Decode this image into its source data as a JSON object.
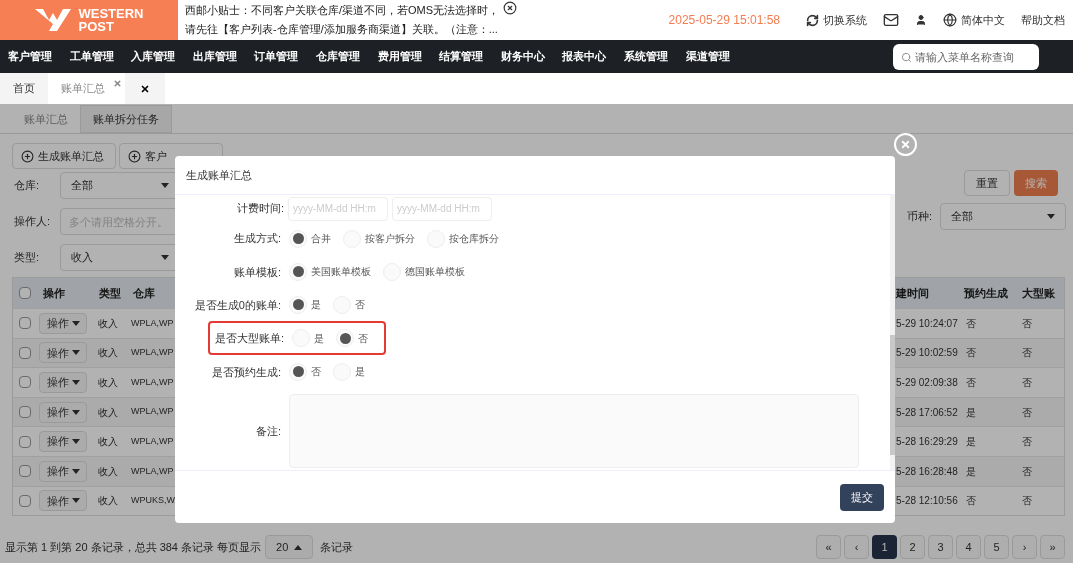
{
  "header": {
    "logo_lines": [
      "WESTERN",
      "POST"
    ],
    "notice_lines": [
      "西邮小贴士：不同客户关联仓库/渠道不同，若OMS无法选择时，",
      "请先往【客户列表-仓库管理/添加服务商渠道】关联。（注意：..."
    ],
    "datetime": "2025-05-29 15:01:58",
    "actions": [
      {
        "kind": "switch",
        "label": "切换系统"
      },
      {
        "kind": "mail"
      },
      {
        "kind": "user"
      },
      {
        "kind": "language",
        "label": "简体中文"
      },
      {
        "kind": "help",
        "label": "帮助文档"
      }
    ]
  },
  "menu": {
    "items": [
      "客户管理",
      "工单管理",
      "入库管理",
      "出库管理",
      "订单管理",
      "仓库管理",
      "费用管理",
      "结算管理",
      "财务中心",
      "报表中心",
      "系统管理",
      "渠道管理"
    ],
    "search": {
      "placeholder": "请输入菜单名称查询"
    }
  },
  "page_tabs": [
    {
      "label": "首页",
      "selected": false,
      "closable": false
    },
    {
      "label": "账单汇总",
      "selected": true,
      "closable": true
    }
  ],
  "sub_tabs": [
    {
      "label": "账单汇总",
      "selected": true
    },
    {
      "label": "账单拆分任务",
      "selected": false
    }
  ],
  "toolbar": [
    "生成账单汇总",
    "客户"
  ],
  "filters": {
    "left": [
      {
        "label": "仓库:",
        "kind": "select",
        "value": "全部"
      },
      {
        "label": "操作人:",
        "kind": "input",
        "placeholder": "多个请用空格分开。"
      },
      {
        "label": "类型:",
        "kind": "select",
        "value": "收入"
      }
    ],
    "buttons": [
      {
        "label": "重置",
        "kind": "default"
      },
      {
        "label": "搜索",
        "kind": "primary"
      }
    ],
    "right": [
      {
        "label": "币种:",
        "kind": "select",
        "value": "全部"
      }
    ]
  },
  "table": {
    "all_checked": false,
    "columns": [
      "操作",
      "类型",
      "仓库",
      "建时间",
      "预约生成",
      "大型账"
    ],
    "rows": [
      {
        "checked": false,
        "action": "操作",
        "type": "收入",
        "warehouse": "WPLA,WP",
        "created": "5-29 10:24:07",
        "scheduled": "否",
        "large": "否"
      },
      {
        "checked": false,
        "action": "操作",
        "type": "收入",
        "warehouse": "WPLA,WP",
        "created": "5-29 10:02:59",
        "scheduled": "否",
        "large": "否"
      },
      {
        "checked": false,
        "action": "操作",
        "type": "收入",
        "warehouse": "WPLA,WP",
        "created": "5-29 02:09:38",
        "scheduled": "否",
        "large": "否"
      },
      {
        "checked": false,
        "action": "操作",
        "type": "收入",
        "warehouse": "WPLA,WP",
        "created": "5-28 17:06:52",
        "scheduled": "是",
        "large": "否"
      },
      {
        "checked": false,
        "action": "操作",
        "type": "收入",
        "warehouse": "WPLA,WP",
        "created": "5-28 16:29:29",
        "scheduled": "是",
        "large": "否"
      },
      {
        "checked": false,
        "action": "操作",
        "type": "收入",
        "warehouse": "WPLA,WP",
        "created": "5-28 16:28:48",
        "scheduled": "是",
        "large": "否"
      },
      {
        "checked": false,
        "action": "操作",
        "type": "收入",
        "warehouse": "WPUKS,W",
        "created": "5-28 12:10:56",
        "scheduled": "否",
        "large": "否"
      }
    ]
  },
  "pagination": {
    "summary": "显示第 1 到第 20 条记录，总共 384 条记录 每页显示",
    "page_size": "20",
    "suffix": "条记录",
    "pages": [
      {
        "label": "«",
        "selected": false
      },
      {
        "label": "‹",
        "selected": false
      },
      {
        "label": "1",
        "selected": true
      },
      {
        "label": "2",
        "selected": false
      },
      {
        "label": "3",
        "selected": false
      },
      {
        "label": "4",
        "selected": false
      },
      {
        "label": "5",
        "selected": false
      },
      {
        "label": "›",
        "selected": false
      },
      {
        "label": "»",
        "selected": false
      }
    ]
  },
  "dialog": {
    "title": "生成账单汇总",
    "fields": [
      {
        "label": "计费时间:",
        "kind": "date_range",
        "placeholders": [
          "yyyy-MM-dd HH:m",
          "yyyy-MM-dd HH:m"
        ]
      },
      {
        "label": "生成方式:",
        "kind": "radio",
        "highlighted": false,
        "options": [
          {
            "label": "合并",
            "selected": true
          },
          {
            "label": "按客户拆分",
            "selected": false
          },
          {
            "label": "按仓库拆分",
            "selected": false
          }
        ]
      },
      {
        "label": "账单模板:",
        "kind": "radio",
        "highlighted": false,
        "options": [
          {
            "label": "美国账单模板",
            "selected": true
          },
          {
            "label": "德国账单模板",
            "selected": false
          }
        ]
      },
      {
        "label": "是否生成0的账单:",
        "kind": "radio",
        "highlighted": false,
        "options": [
          {
            "label": "是",
            "selected": true
          },
          {
            "label": "否",
            "selected": false
          }
        ]
      },
      {
        "label": "是否大型账单:",
        "kind": "radio",
        "highlighted": true,
        "options": [
          {
            "label": "是",
            "selected": false
          },
          {
            "label": "否",
            "selected": true
          }
        ]
      },
      {
        "label": "是否预约生成:",
        "kind": "radio",
        "highlighted": false,
        "options": [
          {
            "label": "否",
            "selected": true
          },
          {
            "label": "是",
            "selected": false
          }
        ]
      },
      {
        "label": "备注:",
        "kind": "textarea"
      }
    ],
    "submit": "提交"
  }
}
